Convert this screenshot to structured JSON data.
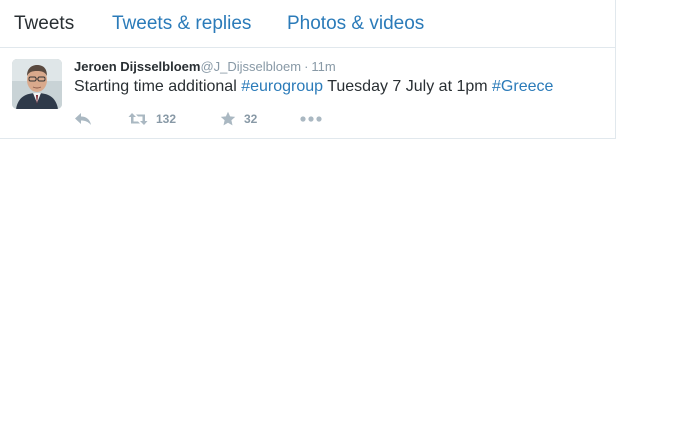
{
  "tabs": {
    "tweets": "Tweets",
    "replies": "Tweets & replies",
    "media": "Photos & videos"
  },
  "tweet": {
    "fullname": "Jeroen Dijsselbloem",
    "username": "@J_Dijsselbloem",
    "separator": "·",
    "time": "11m",
    "text_part1": "Starting time additional ",
    "hashtag1": "#eurogroup",
    "text_part2": " Tuesday 7 July at 1pm ",
    "hashtag2": "#Greece",
    "retweet_count": "132",
    "favorite_count": "32"
  },
  "icons": {
    "reply": "reply-icon",
    "retweet": "retweet-icon",
    "favorite": "star-icon",
    "more": "more-icon"
  },
  "colors": {
    "link": "#2b7bb9",
    "text": "#292f33",
    "muted": "#8899a6",
    "icon": "#aab8c2",
    "border": "#e1e8ed"
  }
}
